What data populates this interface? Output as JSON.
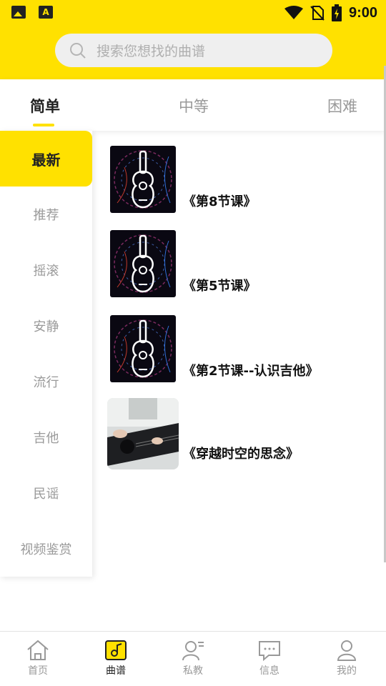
{
  "status_bar": {
    "time": "9:00"
  },
  "search": {
    "placeholder": "搜索您想找的曲谱"
  },
  "tabs": [
    {
      "label": "简单",
      "active": true
    },
    {
      "label": "中等",
      "active": false
    },
    {
      "label": "困难",
      "active": false
    }
  ],
  "sidebar": {
    "items": [
      {
        "label": "最新",
        "active": true
      },
      {
        "label": "推荐"
      },
      {
        "label": "摇滚"
      },
      {
        "label": "安静"
      },
      {
        "label": "流行"
      },
      {
        "label": "吉他"
      },
      {
        "label": "民谣"
      },
      {
        "label": "视频鉴赏"
      }
    ]
  },
  "list": {
    "items": [
      {
        "title": "《第8节课》",
        "thumb": "guitar-lesson-icon"
      },
      {
        "title": "《第5节课》",
        "thumb": "guitar-lesson-icon"
      },
      {
        "title": "《第2节课--认识吉他》",
        "thumb": "guitar-lesson-icon"
      },
      {
        "title": "《穿越时空的思念》",
        "thumb": "guitar-photo"
      }
    ]
  },
  "bottom_nav": {
    "items": [
      {
        "label": "首页",
        "icon": "home-icon"
      },
      {
        "label": "曲谱",
        "icon": "score-icon",
        "active": true
      },
      {
        "label": "私教",
        "icon": "tutor-icon"
      },
      {
        "label": "信息",
        "icon": "message-icon"
      },
      {
        "label": "我的",
        "icon": "profile-icon"
      }
    ]
  },
  "colors": {
    "accent": "#FFE100",
    "text": "#222222",
    "muted": "#999999"
  }
}
